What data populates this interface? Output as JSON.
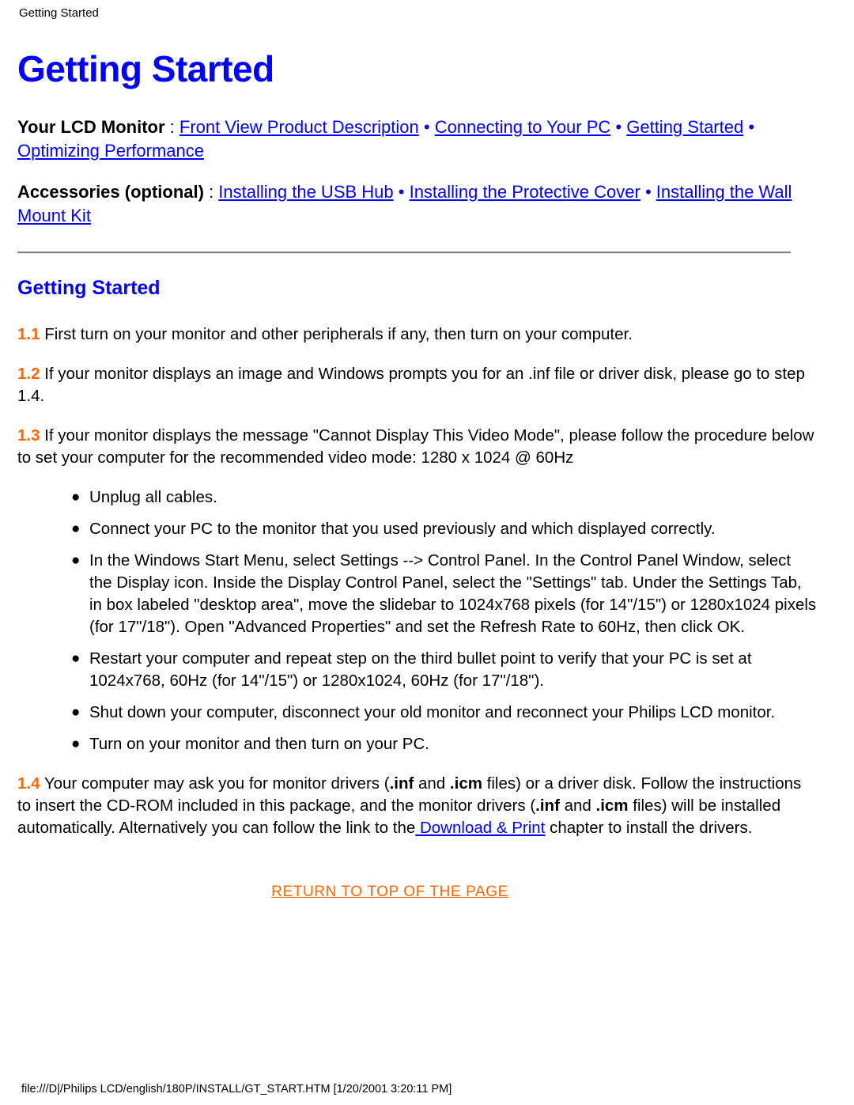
{
  "header": {
    "running_title": "Getting Started"
  },
  "title": "Getting Started",
  "nav": {
    "monitor": {
      "lead": "Your LCD Monitor",
      "colon": " : ",
      "links": [
        "Front View Product Description",
        "Connecting to Your PC",
        "Getting Started",
        "Optimizing Performance"
      ],
      "separator": " • "
    },
    "accessories": {
      "lead": "Accessories (optional)",
      "colon": " : ",
      "links": [
        "Installing the USB Hub",
        "Installing the Protective Cover",
        "Installing the Wall Mount Kit"
      ],
      "separator": " • "
    }
  },
  "section": {
    "heading": "Getting Started",
    "steps": [
      {
        "number": "1.1",
        "text": " First turn on your monitor and other peripherals if any, then turn on your computer."
      },
      {
        "number": "1.2",
        "text": " If your monitor displays an image and Windows prompts you for an .inf file or driver disk, please go to step 1.4."
      },
      {
        "number": "1.3",
        "text": " If your monitor displays the message \"Cannot Display This Video Mode\", please follow the procedure below to set your computer for the recommended video mode: 1280 x 1024 @ 60Hz"
      }
    ],
    "bullets": [
      "Unplug all cables.",
      "Connect your PC to the monitor that you used previously and which displayed correctly.",
      "In the Windows Start Menu, select Settings --> Control Panel. In the Control Panel Window, select the Display icon. Inside the Display Control Panel, select the \"Settings\" tab. Under the Settings Tab, in box labeled \"desktop area\", move the slidebar to 1024x768 pixels (for 14\"/15\") or 1280x1024 pixels (for 17\"/18\"). Open \"Advanced Properties\" and set the Refresh Rate to 60Hz, then click OK.",
      "Restart your computer and repeat step on the third bullet point to verify that your PC is set at 1024x768, 60Hz (for 14\"/15\") or 1280x1024, 60Hz (for 17\"/18\").",
      "Shut down your computer, disconnect your old monitor and reconnect your Philips LCD monitor.",
      "Turn on your monitor and then turn on your PC."
    ],
    "bullet_glyph": "●",
    "step14": {
      "number": "1.4",
      "part1": " Your computer may ask you for monitor drivers (",
      "inf1": ".inf",
      "part2": " and ",
      "icm1": ".icm",
      "part3": " files) or a driver disk. Follow the instructions to insert the CD-ROM included in this package, and the monitor drivers (",
      "inf2": ".inf",
      "part4": " and ",
      "icm2": ".icm",
      "part5": " files) will be installed automatically. Alternatively you can follow the link to the",
      "link": " Download & Print",
      "part6": " chapter to install the drivers."
    }
  },
  "return_to_top": "RETURN TO TOP OF THE PAGE",
  "footer": {
    "path": "file:///D|/Philips LCD/english/180P/INSTALL/GT_START.HTM [1/20/2001 3:20:11 PM]"
  },
  "colors": {
    "link_blue": "#0000FF",
    "accent_orange": "#FF6600",
    "text_black": "#000000",
    "rule_gray": "#808080"
  }
}
